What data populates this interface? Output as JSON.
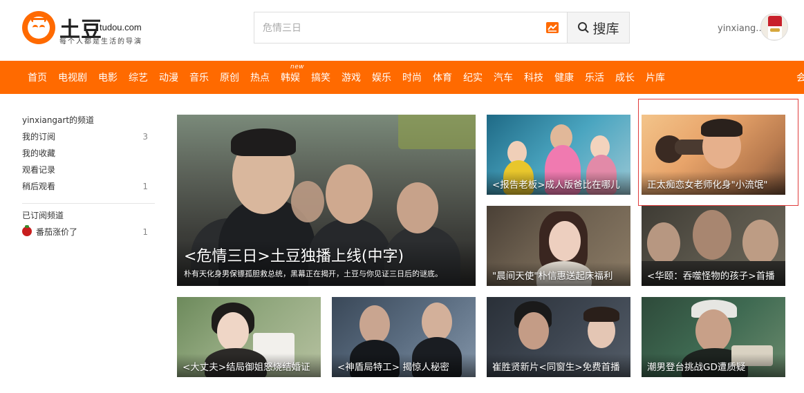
{
  "header": {
    "logo_brand": "土豆",
    "logo_domain": "tudou.com",
    "logo_slogan": "每个人都是生活的导演",
    "search": {
      "value": "危情三日",
      "button_label": "搜库"
    },
    "user": {
      "name": "yinxiang..."
    }
  },
  "nav": {
    "badge": "new",
    "items": [
      "首页",
      "电视剧",
      "电影",
      "综艺",
      "动漫",
      "音乐",
      "原创",
      "热点",
      "韩娱",
      "搞笑",
      "游戏",
      "娱乐",
      "时尚",
      "体育",
      "纪实",
      "汽车",
      "科技",
      "健康",
      "乐活",
      "成长",
      "片库",
      "会"
    ]
  },
  "sidebar": {
    "channel_title": "yinxiangart的频道",
    "items": [
      {
        "label": "我的订阅",
        "count": "3"
      },
      {
        "label": "我的收藏",
        "count": ""
      },
      {
        "label": "观看记录",
        "count": ""
      },
      {
        "label": "稍后观看",
        "count": "1"
      }
    ],
    "subscribed_title": "已订阅频道",
    "subscribed": [
      {
        "label": "番茄涨价了",
        "count": "1"
      }
    ]
  },
  "feature": {
    "title": "<危情三日>土豆独播上线(中字)",
    "subtitle": "朴有天化身男保镖孤胆救总统，黑幕正在揭开，土豆与你见证三日后的谜底。"
  },
  "tiles": [
    {
      "caption": "<报告老板>成人版爸比在哪儿"
    },
    {
      "caption": "正太痴恋女老师化身\"小流氓\""
    },
    {
      "caption": "\"晨间天使\"朴信惠送起床福利"
    },
    {
      "caption": "<华颐：吞噬怪物的孩子>首播"
    },
    {
      "caption": "<大丈夫>结局御姐怒烧结婚证"
    },
    {
      "caption": "<神盾局特工> 揭惊人秘密"
    },
    {
      "caption": "崔胜贤新片<同窗生>免费首播"
    },
    {
      "caption": "潮男登台挑战GD遭质疑"
    }
  ],
  "colors": {
    "accent": "#ff6a00",
    "highlight_border": "#e03a3a"
  }
}
